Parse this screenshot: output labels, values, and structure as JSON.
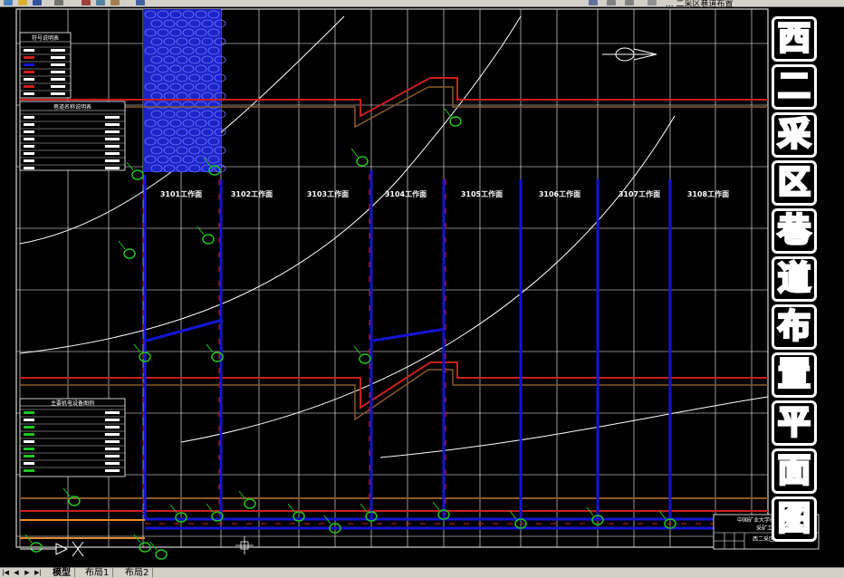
{
  "window": {
    "title_fragment": "... 二采区巷道布置",
    "toolbar_icons": [
      "new-icon",
      "open-icon",
      "save-icon",
      "print-icon",
      "cut-icon",
      "copy-icon",
      "paste-icon",
      "undo-icon"
    ]
  },
  "drawing": {
    "vertical_title_chars": [
      "西",
      "二",
      "采",
      "区",
      "巷",
      "道",
      "布",
      "置",
      "平",
      "面",
      "图"
    ],
    "workfaces": [
      "3101工作面",
      "3102工作面",
      "3103工作面",
      "3104工作面",
      "3105工作面",
      "3106工作面",
      "3107工作面",
      "3108工作面"
    ],
    "legend_symbols_title": "符号说明表",
    "legend_roadway_title": "巷道名称说明表",
    "legend_equipment_title": "主要机电设备图例",
    "title_block": {
      "org_line1": "中国矿业大学矿业工程学院",
      "org_line2": "采矿工程系",
      "drawing_name": "西二采区巷道布置平面图"
    },
    "colors": {
      "background": "#000000",
      "grid": "#ffffff",
      "roadway_red": "#c8201e",
      "roadway_brown": "#8a5a2a",
      "belt_blue": "#1414d2",
      "equipment_green": "#22c322",
      "coal_pillar": "#1c24c8"
    }
  },
  "tabs": {
    "model": "模型",
    "layout1": "布局1",
    "layout2": "布局2"
  }
}
